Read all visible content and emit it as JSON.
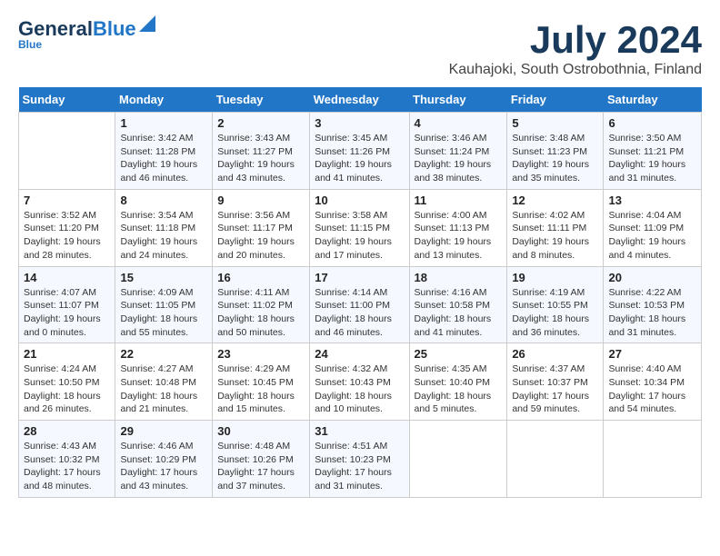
{
  "header": {
    "logo_line1a": "General",
    "logo_line1b": "Blue",
    "main_title": "July 2024",
    "subtitle": "Kauhajoki, South Ostrobothnia, Finland"
  },
  "calendar": {
    "days_of_week": [
      "Sunday",
      "Monday",
      "Tuesday",
      "Wednesday",
      "Thursday",
      "Friday",
      "Saturday"
    ],
    "weeks": [
      [
        {
          "day": "",
          "info": ""
        },
        {
          "day": "1",
          "info": "Sunrise: 3:42 AM\nSunset: 11:28 PM\nDaylight: 19 hours\nand 46 minutes."
        },
        {
          "day": "2",
          "info": "Sunrise: 3:43 AM\nSunset: 11:27 PM\nDaylight: 19 hours\nand 43 minutes."
        },
        {
          "day": "3",
          "info": "Sunrise: 3:45 AM\nSunset: 11:26 PM\nDaylight: 19 hours\nand 41 minutes."
        },
        {
          "day": "4",
          "info": "Sunrise: 3:46 AM\nSunset: 11:24 PM\nDaylight: 19 hours\nand 38 minutes."
        },
        {
          "day": "5",
          "info": "Sunrise: 3:48 AM\nSunset: 11:23 PM\nDaylight: 19 hours\nand 35 minutes."
        },
        {
          "day": "6",
          "info": "Sunrise: 3:50 AM\nSunset: 11:21 PM\nDaylight: 19 hours\nand 31 minutes."
        }
      ],
      [
        {
          "day": "7",
          "info": "Sunrise: 3:52 AM\nSunset: 11:20 PM\nDaylight: 19 hours\nand 28 minutes."
        },
        {
          "day": "8",
          "info": "Sunrise: 3:54 AM\nSunset: 11:18 PM\nDaylight: 19 hours\nand 24 minutes."
        },
        {
          "day": "9",
          "info": "Sunrise: 3:56 AM\nSunset: 11:17 PM\nDaylight: 19 hours\nand 20 minutes."
        },
        {
          "day": "10",
          "info": "Sunrise: 3:58 AM\nSunset: 11:15 PM\nDaylight: 19 hours\nand 17 minutes."
        },
        {
          "day": "11",
          "info": "Sunrise: 4:00 AM\nSunset: 11:13 PM\nDaylight: 19 hours\nand 13 minutes."
        },
        {
          "day": "12",
          "info": "Sunrise: 4:02 AM\nSunset: 11:11 PM\nDaylight: 19 hours\nand 8 minutes."
        },
        {
          "day": "13",
          "info": "Sunrise: 4:04 AM\nSunset: 11:09 PM\nDaylight: 19 hours\nand 4 minutes."
        }
      ],
      [
        {
          "day": "14",
          "info": "Sunrise: 4:07 AM\nSunset: 11:07 PM\nDaylight: 19 hours\nand 0 minutes."
        },
        {
          "day": "15",
          "info": "Sunrise: 4:09 AM\nSunset: 11:05 PM\nDaylight: 18 hours\nand 55 minutes."
        },
        {
          "day": "16",
          "info": "Sunrise: 4:11 AM\nSunset: 11:02 PM\nDaylight: 18 hours\nand 50 minutes."
        },
        {
          "day": "17",
          "info": "Sunrise: 4:14 AM\nSunset: 11:00 PM\nDaylight: 18 hours\nand 46 minutes."
        },
        {
          "day": "18",
          "info": "Sunrise: 4:16 AM\nSunset: 10:58 PM\nDaylight: 18 hours\nand 41 minutes."
        },
        {
          "day": "19",
          "info": "Sunrise: 4:19 AM\nSunset: 10:55 PM\nDaylight: 18 hours\nand 36 minutes."
        },
        {
          "day": "20",
          "info": "Sunrise: 4:22 AM\nSunset: 10:53 PM\nDaylight: 18 hours\nand 31 minutes."
        }
      ],
      [
        {
          "day": "21",
          "info": "Sunrise: 4:24 AM\nSunset: 10:50 PM\nDaylight: 18 hours\nand 26 minutes."
        },
        {
          "day": "22",
          "info": "Sunrise: 4:27 AM\nSunset: 10:48 PM\nDaylight: 18 hours\nand 21 minutes."
        },
        {
          "day": "23",
          "info": "Sunrise: 4:29 AM\nSunset: 10:45 PM\nDaylight: 18 hours\nand 15 minutes."
        },
        {
          "day": "24",
          "info": "Sunrise: 4:32 AM\nSunset: 10:43 PM\nDaylight: 18 hours\nand 10 minutes."
        },
        {
          "day": "25",
          "info": "Sunrise: 4:35 AM\nSunset: 10:40 PM\nDaylight: 18 hours\nand 5 minutes."
        },
        {
          "day": "26",
          "info": "Sunrise: 4:37 AM\nSunset: 10:37 PM\nDaylight: 17 hours\nand 59 minutes."
        },
        {
          "day": "27",
          "info": "Sunrise: 4:40 AM\nSunset: 10:34 PM\nDaylight: 17 hours\nand 54 minutes."
        }
      ],
      [
        {
          "day": "28",
          "info": "Sunrise: 4:43 AM\nSunset: 10:32 PM\nDaylight: 17 hours\nand 48 minutes."
        },
        {
          "day": "29",
          "info": "Sunrise: 4:46 AM\nSunset: 10:29 PM\nDaylight: 17 hours\nand 43 minutes."
        },
        {
          "day": "30",
          "info": "Sunrise: 4:48 AM\nSunset: 10:26 PM\nDaylight: 17 hours\nand 37 minutes."
        },
        {
          "day": "31",
          "info": "Sunrise: 4:51 AM\nSunset: 10:23 PM\nDaylight: 17 hours\nand 31 minutes."
        },
        {
          "day": "",
          "info": ""
        },
        {
          "day": "",
          "info": ""
        },
        {
          "day": "",
          "info": ""
        }
      ]
    ]
  }
}
